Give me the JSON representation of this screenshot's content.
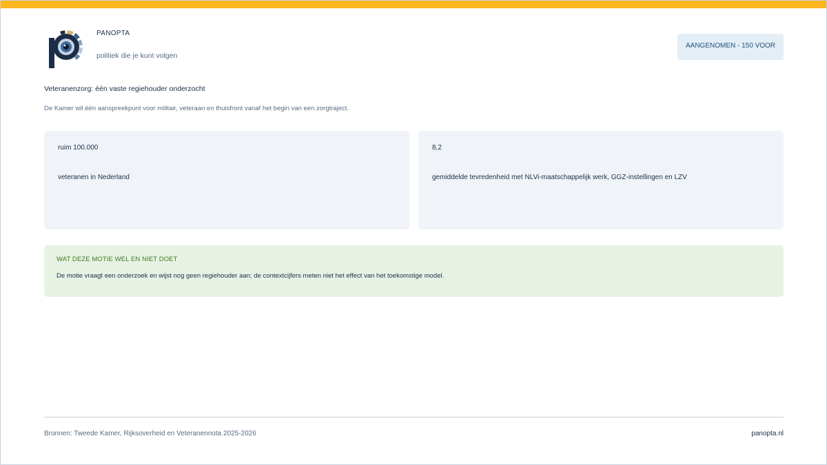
{
  "brand": {
    "name": "PANOPTA",
    "tagline": "politiek die je kunt volgen",
    "logo_icon": "panopta-eye-logo-icon"
  },
  "status": {
    "label": "AANGENOMEN - 150 VOOR"
  },
  "motion": {
    "title": "Veteranenzorg: één vaste regiehouder onderzocht",
    "subtitle": "De Kamer wil één aanspreekpunt voor militair, veteraan en thuisfront vanaf het begin van een zorgtraject."
  },
  "stats": [
    {
      "value": "ruim 100.000",
      "label": "veteranen in Nederland"
    },
    {
      "value": "8,2",
      "label": "gemiddelde tevredenheid met NLVi-maatschappelijk werk, GGZ-instellingen en LZV"
    }
  ],
  "note": {
    "heading": "WAT DEZE MOTIE WEL EN NIET DOET",
    "text": "De motie vraagt een onderzoek en wijst nog geen regiehouder aan; de contextcijfers meten niet het effect van het toekomstige model."
  },
  "footer": {
    "sources": "Bronnen: Tweede Kamer, Rijksoverheid en Veteranennota 2025-2026",
    "link": "panopta.nl"
  },
  "colors": {
    "accent_bar": "#fcb61d",
    "navy": "#1c2d47",
    "badge_bg": "#e3eef6",
    "card_bg": "#f0f4f8",
    "note_bg": "#e7f2e4",
    "note_heading": "#3f7a1e"
  }
}
